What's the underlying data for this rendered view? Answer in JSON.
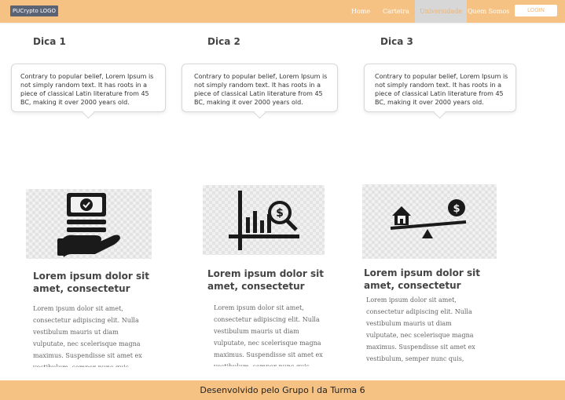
{
  "navbar": {
    "logo": "PUCrypto LOGO",
    "links": [
      "Home",
      "Carteira",
      "Universidade",
      "Quem Somos"
    ],
    "login": "LOGIN"
  },
  "tips": [
    {
      "title": "Dica 1",
      "text": "Contrary to popular belief, Lorem Ipsum is not simply random text. It has roots in a piece of classical Latin literature from 45 BC, making it over 2000 years old."
    },
    {
      "title": "Dica 2",
      "text": "Contrary to popular belief, Lorem Ipsum is not simply random text. It has roots in a piece of classical Latin literature from 45 BC, making it over 2000 years old."
    },
    {
      "title": "Dica 3",
      "text": "Contrary to popular belief, Lorem Ipsum is not simply random text. It has roots in a piece of classical Latin literature from 45 BC, making it over 2000 years old."
    }
  ],
  "features": [
    {
      "icon": "money-hand-icon",
      "title": "Lorem ipsum dolor sit amet, consectetur",
      "text": "Lorem ipsum dolor sit amet, consectetur adipiscing elit. Nulla vestibulum mauris ut diam vulputate, nec scelerisque magna maximus. Suspendisse sit amet ex vestibulum, semper nunc quis,"
    },
    {
      "icon": "chart-search-dollar-icon",
      "title": "Lorem ipsum dolor sit amet, consectetur",
      "text": "Lorem ipsum dolor sit amet, consectetur adipiscing elit. Nulla vestibulum mauris ut diam vulputate, nec scelerisque magna maximus. Suspendisse sit amet ex vestibulum, semper nunc quis,"
    },
    {
      "icon": "house-money-balance-icon",
      "title": "Lorem ipsum dolor sit amet, consectetur",
      "text": "Lorem ipsum dolor sit amet, consectetur adipiscing elit. Nulla vestibulum mauris ut diam vulputate, nec scelerisque magna maximus. Suspendisse sit amet ex vestibulum, semper nunc quis,"
    }
  ],
  "footer": "Desenvolvido pelo Grupo I da Turma 6",
  "colors": {
    "accent": "#f6c283",
    "active_tab": "#d7d7d7"
  }
}
